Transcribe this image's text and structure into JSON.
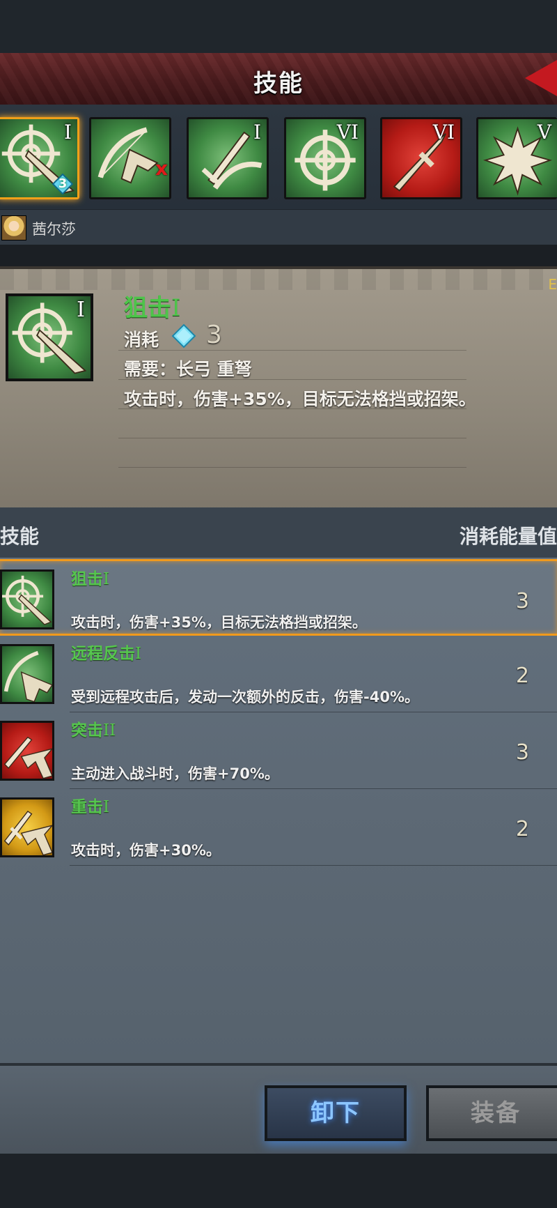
{
  "header": {
    "title": "技能"
  },
  "skill_slots": [
    {
      "roman": "I",
      "badge": "3",
      "color": "green",
      "icon": "sniper-target-icon",
      "selected": true
    },
    {
      "roman": "",
      "color": "green",
      "icon": "counter-shot-icon",
      "disabled_mark": "x"
    },
    {
      "roman": "I",
      "color": "green",
      "icon": "bow-sword-icon"
    },
    {
      "roman": "VI",
      "color": "green",
      "icon": "crosshair-icon"
    },
    {
      "roman": "VI",
      "color": "red",
      "icon": "sword-icon"
    },
    {
      "roman": "V",
      "color": "green",
      "icon": "burst-icon"
    }
  ],
  "character": {
    "name": "茜尔莎"
  },
  "detail": {
    "name": "狙击",
    "roman": "I",
    "cost_label": "消耗",
    "cost_value": "3",
    "requirement": "需要：长弓  重弩",
    "description": "攻击时，伤害+35%，目标无法格挡或招架。",
    "edge_letter": "E"
  },
  "list_header": {
    "left": "技能",
    "right": "消耗能量值"
  },
  "skills": [
    {
      "name": "狙击",
      "roman": "I",
      "desc": "攻击时，伤害+35%，目标无法格挡或招架。",
      "cost": "3",
      "color": "green",
      "icon": "sniper-target-icon",
      "selected": true
    },
    {
      "name": "远程反击",
      "roman": "I",
      "desc": "受到远程攻击后，发动一次额外的反击，伤害-40%。",
      "cost": "2",
      "color": "green",
      "icon": "counter-shot-icon"
    },
    {
      "name": "突击",
      "roman": "II",
      "desc": "主动进入战斗时，伤害+70%。",
      "cost": "3",
      "color": "red",
      "icon": "charge-icon"
    },
    {
      "name": "重击",
      "roman": "I",
      "desc": "攻击时，伤害+30%。",
      "cost": "2",
      "color": "gold",
      "icon": "heavy-strike-icon"
    }
  ],
  "buttons": {
    "unequip": "卸下",
    "equip": "装备"
  },
  "colors": {
    "accent_orange": "#f19a1c",
    "skill_green": "#4ec44a",
    "title_red": "#4c1c1e"
  }
}
